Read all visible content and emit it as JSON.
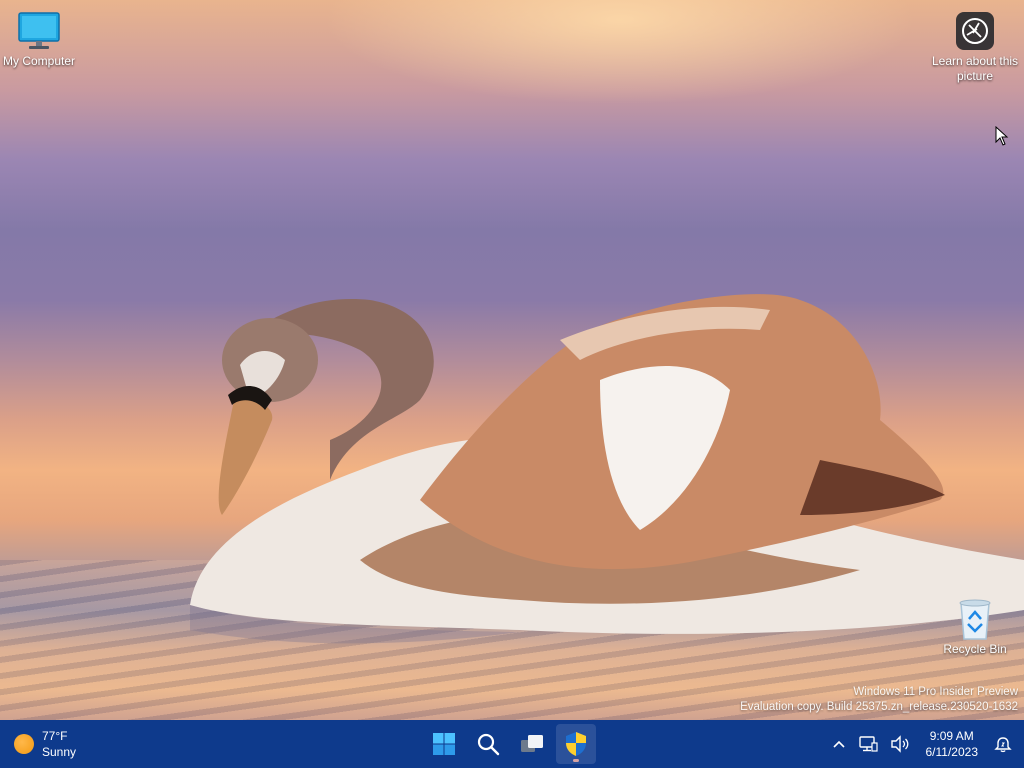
{
  "desktop": {
    "icons": [
      {
        "label": "My Computer",
        "icon": "monitor-icon"
      },
      {
        "label": "Learn about this picture",
        "icon": "camera-icon"
      },
      {
        "label": "Recycle Bin",
        "icon": "recycle-bin-icon"
      }
    ],
    "watermark": {
      "line1": "Windows 11 Pro Insider Preview",
      "line2": "Evaluation copy. Build 25375.zn_release.230520-1632"
    }
  },
  "taskbar": {
    "weather": {
      "temperature": "77°F",
      "condition": "Sunny",
      "icon": "sun-icon"
    },
    "apps": [
      {
        "name": "Start",
        "icon": "windows-logo-icon"
      },
      {
        "name": "Search",
        "icon": "search-icon"
      },
      {
        "name": "Task View",
        "icon": "task-view-icon"
      },
      {
        "name": "Security",
        "icon": "shield-icon"
      }
    ],
    "tray": {
      "time": "9:09 AM",
      "date": "6/11/2023"
    }
  },
  "colors": {
    "taskbar": "#0e3a8c",
    "accent": "#1e88e5"
  }
}
